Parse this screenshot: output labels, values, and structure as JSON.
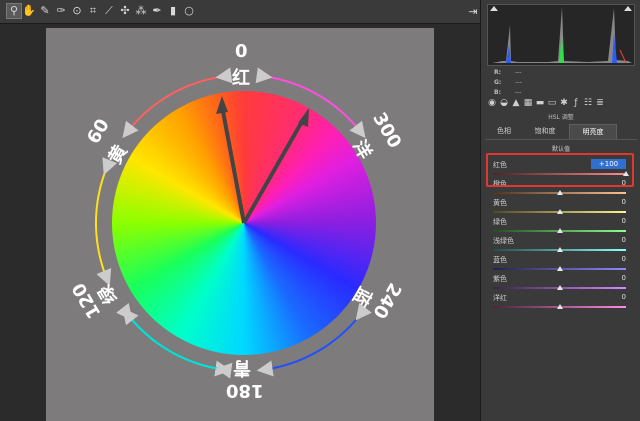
{
  "toolbar": {
    "tools": [
      {
        "name": "zoom-tool-icon",
        "glyph": "⚲"
      },
      {
        "name": "hand-tool-icon",
        "glyph": "✋"
      },
      {
        "name": "white-balance-tool-icon",
        "glyph": "✎"
      },
      {
        "name": "color-sampler-tool-icon",
        "glyph": "✑"
      },
      {
        "name": "targeted-adjustment-tool-icon",
        "glyph": "⊙"
      },
      {
        "name": "crop-tool-icon",
        "glyph": "⌗"
      },
      {
        "name": "straighten-tool-icon",
        "glyph": "⟋"
      },
      {
        "name": "spot-removal-tool-icon",
        "glyph": "✣"
      },
      {
        "name": "red-eye-tool-icon",
        "glyph": "⁂"
      },
      {
        "name": "adjustment-brush-icon",
        "glyph": "✒"
      },
      {
        "name": "graduated-filter-icon",
        "glyph": "▮"
      },
      {
        "name": "radial-filter-icon",
        "glyph": "○"
      }
    ],
    "right_icon": "⇥"
  },
  "wheel": {
    "numbers": {
      "n0": "0",
      "n60": "60",
      "n120": "120",
      "n180": "180",
      "n240": "240",
      "n300": "300"
    },
    "names": {
      "red": "红",
      "yellow": "黄",
      "green": "绿",
      "cyan": "青",
      "blue": "蓝",
      "magenta": "洋"
    }
  },
  "panel": {
    "rgb_labels": [
      "R:",
      "G:",
      "B:"
    ],
    "rgb_values": [
      "---",
      "---",
      "---"
    ],
    "section_title": "HSL 调整",
    "tabs": [
      {
        "label": "色相"
      },
      {
        "label": "饱和度"
      },
      {
        "label": "明亮度"
      }
    ],
    "default_label": "默认值",
    "sliders": [
      {
        "label": "红色",
        "value": "+100",
        "colors": [
          "#4d2323",
          "#ff8a8a"
        ],
        "level": 1.0
      },
      {
        "label": "橙色",
        "value": "0",
        "colors": [
          "#4d3323",
          "#ffc08a"
        ],
        "level": 0.5
      },
      {
        "label": "黄色",
        "value": "0",
        "colors": [
          "#4d4a23",
          "#fff48a"
        ],
        "level": 0.5
      },
      {
        "label": "绿色",
        "value": "0",
        "colors": [
          "#234d23",
          "#8aff8a"
        ],
        "level": 0.5
      },
      {
        "label": "浅绿色",
        "value": "0",
        "colors": [
          "#234d4d",
          "#8affff"
        ],
        "level": 0.5
      },
      {
        "label": "蓝色",
        "value": "0",
        "colors": [
          "#23234d",
          "#8a8aff"
        ],
        "level": 0.5
      },
      {
        "label": "紫色",
        "value": "0",
        "colors": [
          "#3d234d",
          "#d28aff"
        ],
        "level": 0.5
      },
      {
        "label": "洋红",
        "value": "0",
        "colors": [
          "#4d2340",
          "#ff8ae0"
        ],
        "level": 0.5
      }
    ],
    "highlight_color": "#e0382f"
  }
}
